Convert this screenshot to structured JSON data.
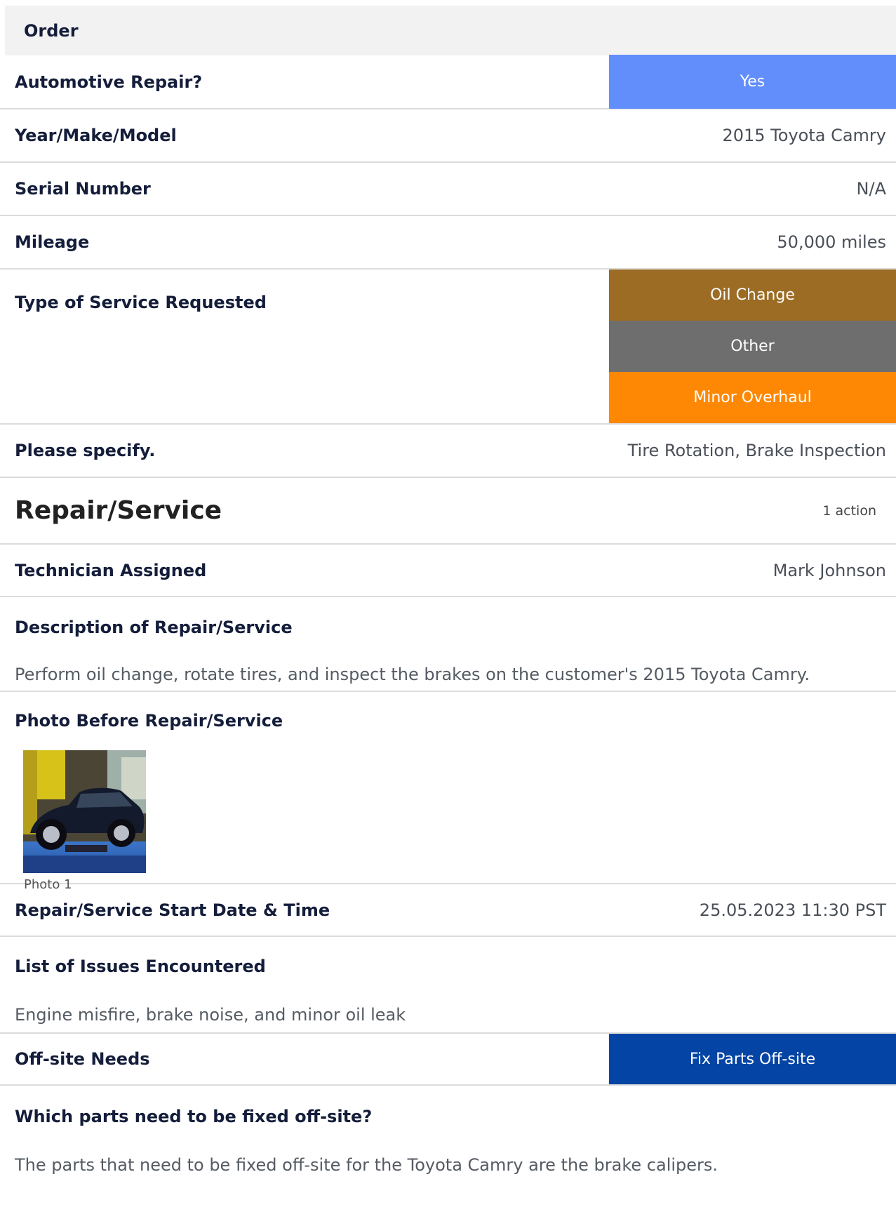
{
  "order": {
    "header": "Order",
    "automotive_repair": {
      "label": "Automotive Repair?",
      "value": "Yes",
      "color": "#628efc"
    },
    "year_make_model": {
      "label": "Year/Make/Model",
      "value": "2015 Toyota Camry"
    },
    "serial_number": {
      "label": "Serial Number",
      "value": "N/A"
    },
    "mileage": {
      "label": "Mileage",
      "value": "50,000 miles"
    },
    "service_type": {
      "label": "Type of Service Requested",
      "options": [
        {
          "label": "Oil Change",
          "color": "#9c6c24"
        },
        {
          "label": "Other",
          "color": "#6e6e6e"
        },
        {
          "label": "Minor Overhaul",
          "color": "#fe8804"
        }
      ]
    },
    "please_specify": {
      "label": "Please specify.",
      "value": "Tire Rotation, Brake Inspection"
    }
  },
  "repair": {
    "title": "Repair/Service",
    "actions": "1 action",
    "technician": {
      "label": "Technician Assigned",
      "value": "Mark Johnson"
    },
    "description": {
      "label": "Description of Repair/Service",
      "value": "Perform oil change, rotate tires, and inspect the brakes on the customer's 2015 Toyota Camry."
    },
    "photo": {
      "label": "Photo Before Repair/Service",
      "caption": "Photo 1"
    },
    "start": {
      "label": "Repair/Service Start Date & Time",
      "value": "25.05.2023 11:30 PST"
    },
    "issues": {
      "label": "List of Issues Encountered",
      "value": "Engine misfire, brake noise, and minor oil leak"
    },
    "offsite": {
      "label": "Off-site Needs",
      "value": "Fix Parts Off-site",
      "color": "#0444a4"
    },
    "offsite_parts": {
      "label": "Which parts need to be fixed off-site?",
      "value": "The parts that need to be fixed off-site for the Toyota Camry are the brake calipers."
    }
  }
}
